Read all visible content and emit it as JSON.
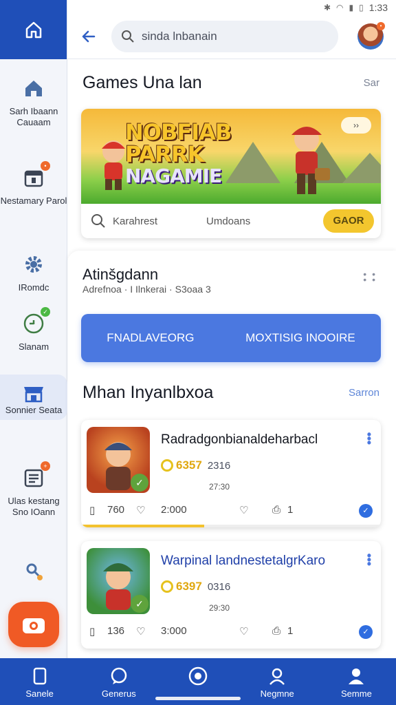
{
  "status_bar": {
    "time": "1:33"
  },
  "rail": {
    "items": [
      {
        "label": "Sarh Ibaann Cauaam",
        "icon": "home-icon"
      },
      {
        "label": "Nestamary Parol",
        "icon": "calendar-icon",
        "badge": ""
      },
      {
        "label": "IRomdc",
        "icon": "gear-icon"
      },
      {
        "label": "Slanam",
        "icon": "chat-icon",
        "badge": ""
      },
      {
        "label": "Sonnier Seata",
        "icon": "store-icon"
      },
      {
        "label": "Ulas kestang Sno IOann",
        "icon": "document-icon",
        "badge": ""
      },
      {
        "label": "",
        "icon": "tools-icon"
      }
    ],
    "fab_icon": "camera-icon",
    "top_icon": "home-icon"
  },
  "header": {
    "search_text": "sinda lnbanain"
  },
  "games_section": {
    "title": "Games Una lan",
    "see_all": "Sar"
  },
  "banner": {
    "logo_lines": [
      "NOBFIAB",
      "PARRK",
      "NAGAMIE"
    ],
    "pill": "››",
    "search_label": "Karahrest",
    "meta": "Umdoans",
    "button": "GAOR"
  },
  "panel": {
    "title": "Atinšgdann",
    "subtitle": "Adrefnoa · I Ilnkerai · S3oaa 3",
    "cta_left": "FNADLAVEORG",
    "cta_right": "MOXTISIG INOOIRE"
  },
  "list_section": {
    "title": "Mhan Inyanlbxoa",
    "see_all": "Sarron"
  },
  "games": [
    {
      "name": "Radradgonbianaldeharbacl",
      "coins": "6357",
      "extra": "2316",
      "sub": "27:30",
      "stat1": "760",
      "stat2": "2:000",
      "stat3": "1",
      "progress": 0.41
    },
    {
      "name": "Warpinal landnestetalgrKaro",
      "coins": "6397",
      "extra": "0316",
      "sub": "29:30",
      "stat1": "136",
      "stat2": "3:000",
      "stat3": "1",
      "progress": 0
    }
  ],
  "bottom_nav": [
    {
      "label": "Sanele",
      "icon": "bookmark-icon"
    },
    {
      "label": "Generus",
      "icon": "chat-bubble-icon"
    },
    {
      "label": "",
      "icon": "target-icon"
    },
    {
      "label": "Negmne",
      "icon": "person-outline-icon"
    },
    {
      "label": "Semme",
      "icon": "person-icon"
    }
  ]
}
